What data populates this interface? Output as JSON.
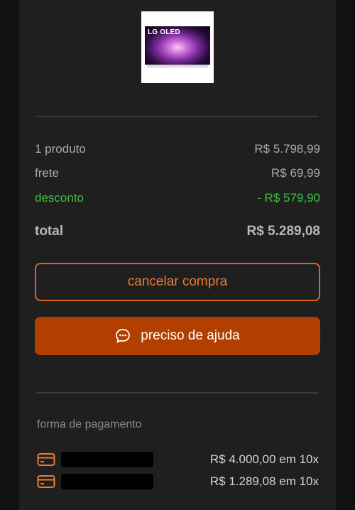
{
  "product": {
    "image_text": "LG OLED"
  },
  "summary": {
    "products_label": "1 produto",
    "products_value": "R$ 5.798,99",
    "shipping_label": "frete",
    "shipping_value": "R$ 69,99",
    "discount_label": "desconto",
    "discount_value": "- R$ 579,90",
    "total_label": "total",
    "total_value": "R$ 5.289,08"
  },
  "actions": {
    "cancel_label": "cancelar compra",
    "help_label": "preciso de ajuda"
  },
  "payment": {
    "section_label": "forma de pagamento",
    "methods": [
      {
        "amount": "R$ 4.000,00 em 10x",
        "icon": "credit-card-icon"
      },
      {
        "amount": "R$ 1.289,08 em 10x",
        "icon": "credit-card-icon"
      }
    ]
  },
  "colors": {
    "accent": "#e0641c",
    "help_button": "#b23f00",
    "discount": "#3fbf3f",
    "panel": "#1f1f1f",
    "background": "#111111"
  }
}
